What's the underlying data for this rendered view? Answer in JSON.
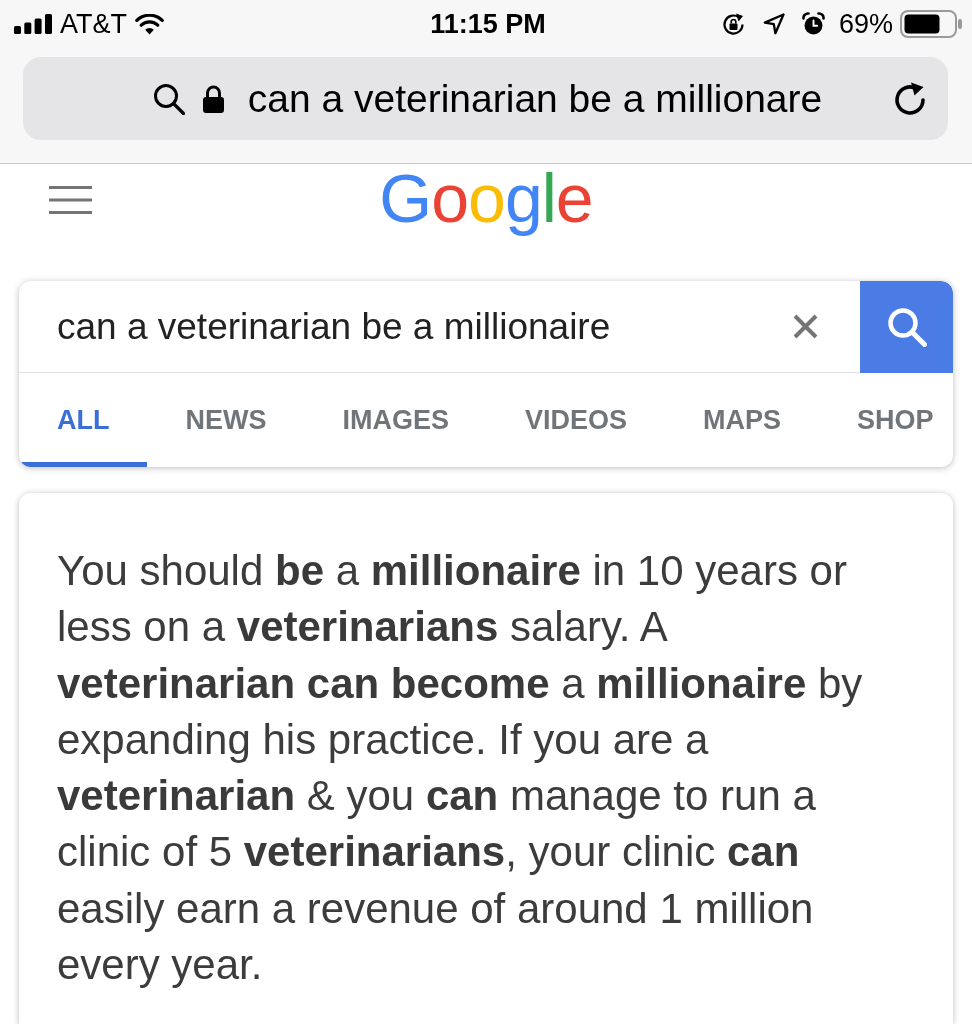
{
  "status_bar": {
    "carrier": "AT&T",
    "time": "11:15 PM",
    "battery": "69%"
  },
  "address_bar": {
    "text": "can a veterinarian be a millionare"
  },
  "logo": "Google",
  "search": {
    "query": "can a veterinarian be a millionaire"
  },
  "tabs": [
    {
      "label": "ALL",
      "selected": true
    },
    {
      "label": "NEWS",
      "selected": false
    },
    {
      "label": "IMAGES",
      "selected": false
    },
    {
      "label": "VIDEOS",
      "selected": false
    },
    {
      "label": "MAPS",
      "selected": false
    },
    {
      "label": "SHOP",
      "selected": false
    }
  ],
  "answer": {
    "text": "You should **be** a **millionaire** in 10 years or less on a **veterinarians** salary. A **veterinarian can become** a **millionaire** by expanding his practice. If you are a **veterinarian** & you **can** manage to run a clinic of 5 **veterinarians**, your clinic **can** easily earn a revenue of around 1 million every year."
  }
}
